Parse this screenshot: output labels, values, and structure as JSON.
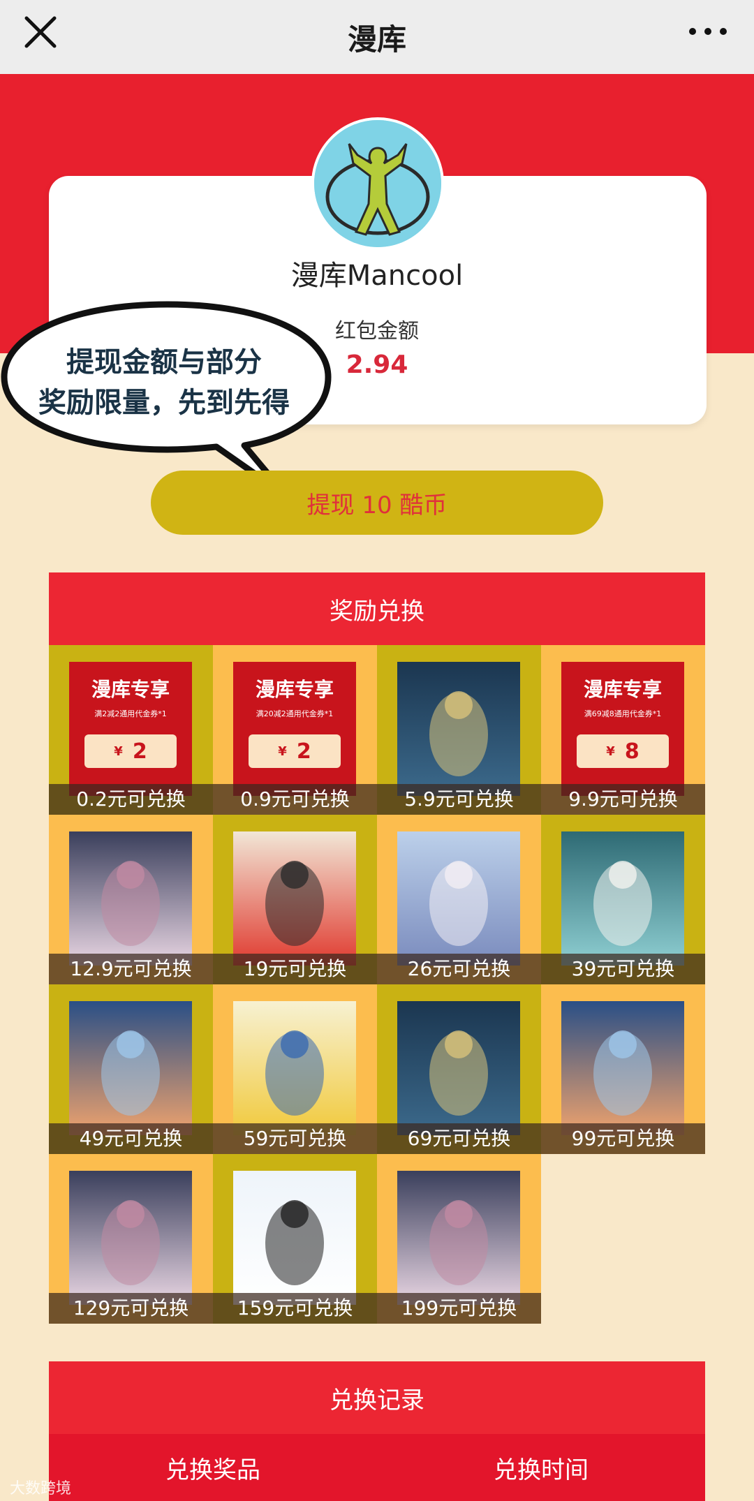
{
  "topbar": {
    "title": "漫库",
    "close_icon": "close-icon",
    "more_icon": "more-dots-icon"
  },
  "profile": {
    "username": "漫库Mancool",
    "balance_label": "红包金额",
    "balance_value": "2.94"
  },
  "bubble": {
    "line1": "提现金额与部分",
    "line2": "奖励限量，先到先得"
  },
  "withdraw": {
    "label": "提现 10 酷币"
  },
  "rewards": {
    "title": "奖励兑换",
    "items": [
      {
        "price": "0.2元可兑换",
        "kind": "voucher",
        "v_title": "漫库专享",
        "v_desc": "满2减2通用代金券*1",
        "v_yen": "¥",
        "v_amount": "2"
      },
      {
        "price": "0.9元可兑换",
        "kind": "voucher",
        "v_title": "漫库专享",
        "v_desc": "满20减2通用代金券*1",
        "v_yen": "¥",
        "v_amount": "2"
      },
      {
        "price": "5.9元可兑换",
        "kind": "image",
        "icon": "book-cover-icon"
      },
      {
        "price": "9.9元可兑换",
        "kind": "voucher",
        "v_title": "漫库专享",
        "v_desc": "满69减8通用代金券*1",
        "v_yen": "¥",
        "v_amount": "8"
      },
      {
        "price": "12.9元可兑换",
        "kind": "image",
        "icon": "anime-figure-icon"
      },
      {
        "price": "19元可兑换",
        "kind": "image",
        "icon": "game-console-bundle-icon"
      },
      {
        "price": "26元可兑换",
        "kind": "image",
        "icon": "anime-poster-icon"
      },
      {
        "price": "39元可兑换",
        "kind": "image",
        "icon": "merch-box-icon"
      },
      {
        "price": "49元可兑换",
        "kind": "image",
        "icon": "novel-cover-icon"
      },
      {
        "price": "59元可兑换",
        "kind": "image",
        "icon": "pokemon-book-icon"
      },
      {
        "price": "69元可兑换",
        "kind": "image",
        "icon": "book-cover-icon"
      },
      {
        "price": "99元可兑换",
        "kind": "image",
        "icon": "novel-cover-icon"
      },
      {
        "price": "129元可兑换",
        "kind": "image",
        "icon": "anime-figure-icon"
      },
      {
        "price": "159元可兑换",
        "kind": "image",
        "icon": "panda-mascot-icon"
      },
      {
        "price": "199元可兑换",
        "kind": "image",
        "icon": "anime-figure-icon"
      }
    ]
  },
  "records": {
    "title": "兑换记录",
    "col_prize": "兑换奖品",
    "col_time": "兑换时间"
  },
  "watermark": "大数跨境",
  "colors": {
    "brand_red": "#e8202e",
    "cream_bg": "#f9e8c9",
    "olive": "#c9b213",
    "orange": "#fcbd4e"
  }
}
